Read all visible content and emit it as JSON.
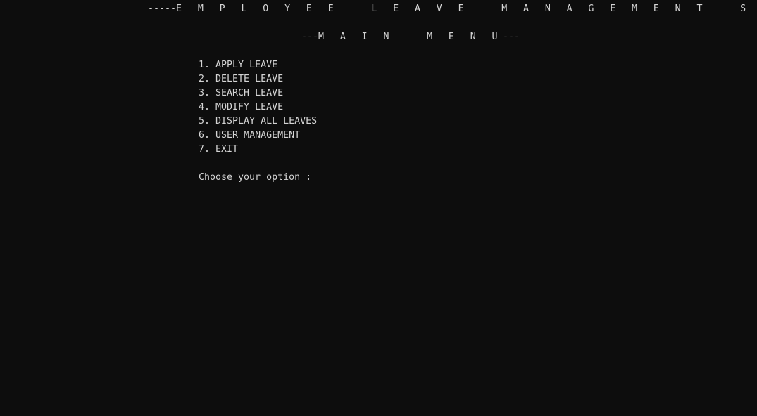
{
  "terminal": {
    "background_color": "#0d0d0d",
    "text_color": "#d4d4d4"
  },
  "banner": {
    "title_dashes_left": "-----",
    "title_text": "E M P L O Y E E   L E A V E   M A N A G E M E N T   S Y S T E M",
    "title_dashes_right": "-----",
    "subtitle_dashes_left": "---",
    "subtitle_text": "M A I N   M E N U",
    "subtitle_dashes_right": "---"
  },
  "menu": {
    "items": [
      {
        "number": "1.",
        "label": "APPLY LEAVE"
      },
      {
        "number": "2.",
        "label": "DELETE LEAVE"
      },
      {
        "number": "3.",
        "label": "SEARCH LEAVE"
      },
      {
        "number": "4.",
        "label": "MODIFY LEAVE"
      },
      {
        "number": "5.",
        "label": "DISPLAY ALL LEAVES"
      },
      {
        "number": "6.",
        "label": "USER MANAGEMENT"
      },
      {
        "number": "7.",
        "label": "EXIT"
      }
    ]
  },
  "prompt": {
    "text": "Choose your option :"
  }
}
